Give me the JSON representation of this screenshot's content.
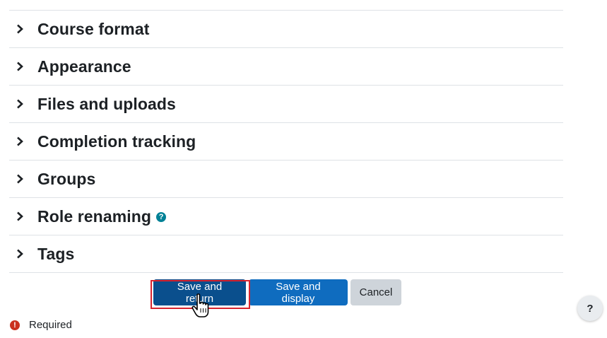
{
  "sections": [
    {
      "label": "Course format"
    },
    {
      "label": "Appearance"
    },
    {
      "label": "Files and uploads"
    },
    {
      "label": "Completion tracking"
    },
    {
      "label": "Groups"
    },
    {
      "label": "Role renaming"
    },
    {
      "label": "Tags"
    }
  ],
  "role_renaming_help_icon": "question-circle-icon",
  "buttons": {
    "save_and_return": "Save and return",
    "save_and_display": "Save and display",
    "cancel": "Cancel"
  },
  "required": {
    "icon": "exclamation-circle-icon",
    "label": "Required"
  },
  "help_fab": {
    "label": "?"
  },
  "colors": {
    "primary": "#0f6cbf",
    "primary_pressed": "#0a4f8d",
    "secondary": "#ced4da",
    "required_icon": "#ca3120",
    "help_icon": "#008196",
    "highlight": "#d9232e"
  }
}
